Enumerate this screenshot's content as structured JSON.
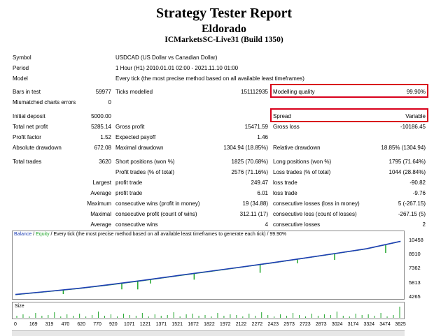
{
  "header": {
    "title": "Strategy Tester Report",
    "ea_name": "Eldorado",
    "server": "ICMarketsSC-Live31 (Build 1350)"
  },
  "info": [
    {
      "label": "Symbol",
      "value": "USDCAD (US Dollar vs Canadian Dollar)"
    },
    {
      "label": "Period",
      "value": "1 Hour (H1) 2010.01.01 02:00 - 2021.11.10 01:00"
    },
    {
      "label": "Model",
      "value": "Every tick (the most precise method based on all available least timeframes)"
    }
  ],
  "bars": {
    "bars_label": "Bars in test",
    "bars_value": "59977",
    "ticks_label": "Ticks modelled",
    "ticks_value": "151112935",
    "mq_label": "Modelling quality",
    "mq_value": "99.90%",
    "mismatch_label": "Mismatched charts errors",
    "mismatch_value": "0"
  },
  "deposit": {
    "initial_label": "Initial deposit",
    "initial_value": "5000.00",
    "spread_label": "Spread",
    "spread_value": "Variable",
    "net_label": "Total net profit",
    "net_value": "5285.14",
    "gp_label": "Gross profit",
    "gp_value": "15471.59",
    "gl_label": "Gross loss",
    "gl_value": "-10186.45",
    "pf_label": "Profit factor",
    "pf_value": "1.52",
    "ep_label": "Expected payoff",
    "ep_value": "1.46",
    "ad_label": "Absolute drawdown",
    "ad_value": "672.08",
    "md_label": "Maximal drawdown",
    "md_value": "1304.94 (18.85%)",
    "rd_label": "Relative drawdown",
    "rd_value": "18.85% (1304.94)"
  },
  "trades": {
    "total_label": "Total trades",
    "total_value": "3620",
    "short_label": "Short positions (won %)",
    "short_value": "1825 (70.68%)",
    "long_label": "Long positions (won %)",
    "long_value": "1795 (71.64%)",
    "pt_label": "Profit trades (% of total)",
    "pt_value": "2576 (71.16%)",
    "lt_label": "Loss trades (% of total)",
    "lt_value": "1044 (28.84%)",
    "largest_label": "Largest",
    "lp_label": "profit trade",
    "lp_value": "249.47",
    "ll_label": "loss trade",
    "ll_value": "-90.82",
    "average_label": "Average",
    "ap_label": "profit trade",
    "ap_value": "6.01",
    "al_label": "loss trade",
    "al_value": "-9.76",
    "maximum_label": "Maximum",
    "mcw_label": "consecutive wins (profit in money)",
    "mcw_value": "19 (34.88)",
    "mcl_label": "consecutive losses (loss in money)",
    "mcl_value": "5 (-267.15)",
    "maximal_label": "Maximal",
    "mcp_label": "consecutive profit (count of wins)",
    "mcp_value": "312.11 (17)",
    "mcll_label": "consecutive loss (count of losses)",
    "mcll_value": "-267.15 (5)",
    "average2_label": "Average",
    "acw_label": "consecutive wins",
    "acw_value": "4",
    "acl_label": "consecutive losses",
    "acl_value": "2"
  },
  "chart_legend": {
    "balance": "Balance",
    "sep": " / ",
    "equity": "Equity",
    "rest": " / Every tick (the most precise method based on all available least timeframes to generate each tick) / 99.90%"
  },
  "size_label": "Size",
  "colors": {
    "balance": "#1e3fb4",
    "equity": "#1fa52a",
    "highlight": "#d9001b"
  },
  "chart_data": {
    "type": "line",
    "title": "",
    "series": [
      {
        "name": "Balance",
        "x": [
          0,
          300,
          600,
          900,
          1200,
          1500,
          1800,
          2100,
          2400,
          2700,
          3000,
          3300,
          3620
        ],
        "values": [
          4450,
          4780,
          5130,
          5550,
          6000,
          6480,
          6950,
          7420,
          7900,
          8410,
          8930,
          9460,
          10270
        ]
      },
      {
        "name": "Equity",
        "x": [
          0,
          300,
          600,
          900,
          1200,
          1500,
          1800,
          2100,
          2400,
          2700,
          3000,
          3300,
          3620
        ],
        "values": [
          4420,
          4750,
          5100,
          5510,
          5960,
          6440,
          6910,
          7390,
          7870,
          8380,
          8900,
          9430,
          10250
        ]
      }
    ],
    "y_ticks": [
      "10458",
      "8910",
      "7362",
      "5813",
      "4265"
    ],
    "x_ticks": [
      "0",
      "169",
      "319",
      "470",
      "620",
      "770",
      "920",
      "1071",
      "1221",
      "1371",
      "1521",
      "1672",
      "1822",
      "1972",
      "2122",
      "2272",
      "2423",
      "2573",
      "2723",
      "2873",
      "3024",
      "3174",
      "3324",
      "3474",
      "3625"
    ],
    "ylim": [
      4265,
      10458
    ],
    "xlim": [
      0,
      3625
    ]
  }
}
